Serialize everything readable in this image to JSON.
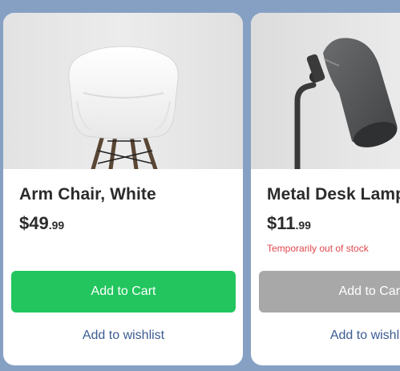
{
  "products": [
    {
      "title": "Arm Chair, White",
      "price_whole": "$49",
      "price_cents": ".99",
      "stock_note": "",
      "cart_label": "Add to Cart",
      "cart_enabled": true,
      "wishlist_label": "Add to wishlist",
      "image_icon": "white-arm-chair"
    },
    {
      "title": "Metal Desk Lamp",
      "price_whole": "$11",
      "price_cents": ".99",
      "stock_note": "Temporarily out of stock",
      "cart_label": "Add to Cart",
      "cart_enabled": false,
      "wishlist_label": "Add to wishlist",
      "image_icon": "metal-desk-lamp"
    }
  ],
  "colors": {
    "page_background": "#86a0c4",
    "add_to_cart_enabled": "#22c55e",
    "add_to_cart_disabled": "#a8a8a8",
    "out_of_stock_text": "#e0474c",
    "wishlist_link": "#3b5c92"
  }
}
